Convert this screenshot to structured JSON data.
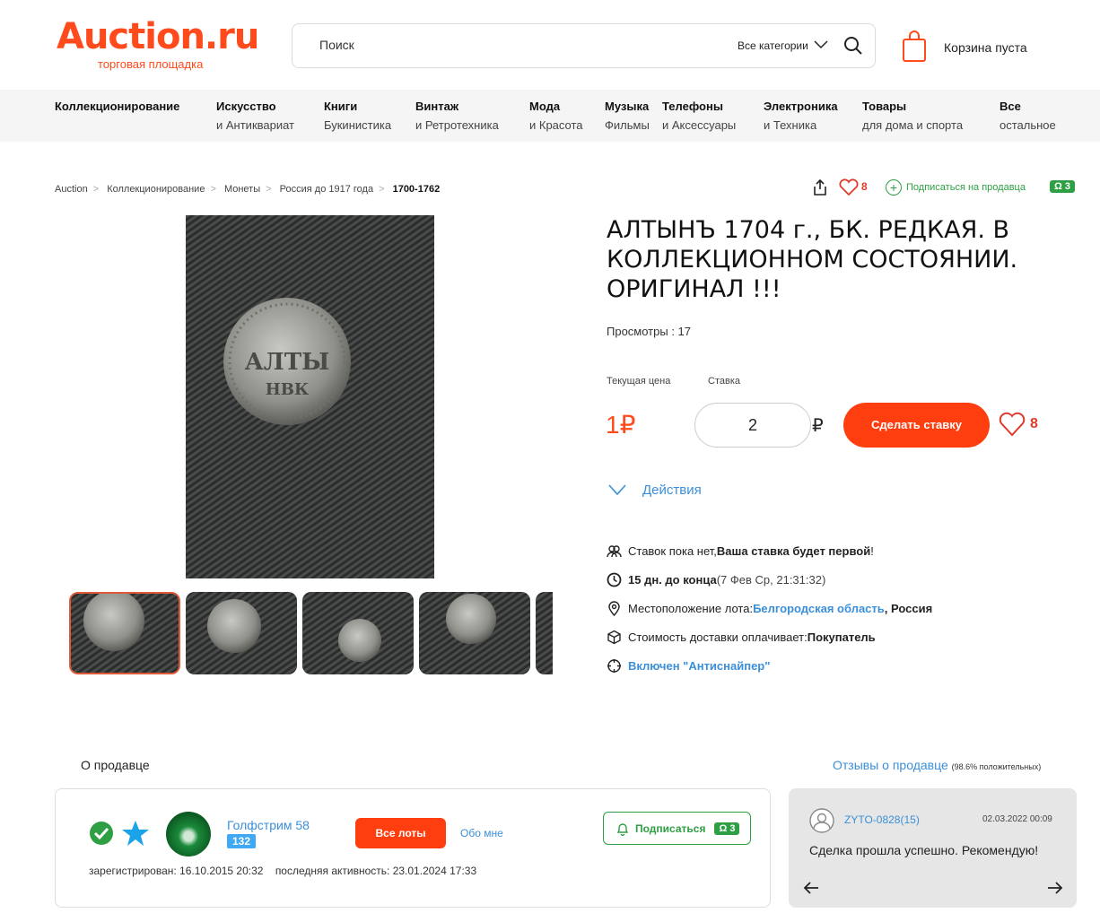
{
  "header": {
    "logo_main": "Auction.ru",
    "logo_sub": "торговая площадка",
    "search_placeholder": "Поиск",
    "category_select": "Все категории",
    "cart_text": "Корзина пуста"
  },
  "nav": [
    {
      "title": "Коллекционирование",
      "sub": ""
    },
    {
      "title": "Искусство",
      "sub": "и Антиквариат"
    },
    {
      "title": "Книги",
      "sub": "Букинистика"
    },
    {
      "title": "Винтаж",
      "sub": "и Ретротехника"
    },
    {
      "title": "Мода",
      "sub": "и Красота"
    },
    {
      "title": "Музыка",
      "sub": "Фильмы"
    },
    {
      "title": "Телефоны",
      "sub": "и Аксессуары"
    },
    {
      "title": "Электроника",
      "sub": "и Техника"
    },
    {
      "title": "Товары",
      "sub": "для дома и спорта"
    },
    {
      "title": "Все",
      "sub": "остальное"
    }
  ],
  "breadcrumbs": [
    "Auction",
    "Коллекционирование",
    "Монеты",
    "Россия до 1917 года",
    "1700-1762"
  ],
  "top_actions": {
    "favorites_count": "8",
    "subscribe_label": "Подписаться на продавца",
    "subscribers_count": "3"
  },
  "lot": {
    "title": "АЛТЫНЪ 1704 г., БК. РЕДКАЯ. В КОЛЛЕКЦИОННОМ СОСТОЯНИИ. ОРИГИНАЛ !!!",
    "views": "Просмотры : 17",
    "current_price_label": "Текущая цена",
    "bid_label": "Ставка",
    "current_price": "1₽",
    "bid_value": "2",
    "currency": "₽",
    "bid_button": "Сделать ставку",
    "favorites_count": "8",
    "actions_label": "Действия"
  },
  "info": {
    "bids_text": "Ставок пока нет, ",
    "bids_bold": "Ваша ставка будет первой",
    "bids_end": "!",
    "time_bold": "15 дн. до конца",
    "time_rest": " (7 Фев Ср, 21:31:32)",
    "location_label": "Местоположение лота: ",
    "location_region": "Белгородская область",
    "location_country": ", Россия",
    "delivery_label": "Стоимость доставки оплачивает: ",
    "delivery_value": "Покупатель",
    "antisniper": "Включен \"Антиснайпер\""
  },
  "seller": {
    "section_title": "О продавце",
    "reviews_link": "Отзывы о продавце",
    "reviews_pct": "(98.6% положительных)",
    "name": "Голфстрим 58",
    "rating": "132",
    "all_lots": "Все лоты",
    "about_me": "Обо мне",
    "subscribe": "Подписаться",
    "subscribers": "3",
    "registered": "зарегистрирован: 16.10.2015 20:32",
    "last_activity": "последняя активность: 23.01.2024 17:33"
  },
  "review": {
    "author": "ZYTO-0828(15)",
    "date": "02.03.2022 00:09",
    "text": "Сделка прошла успешно. Рекомендую!"
  },
  "colors": {
    "brand": "#ff4a1c",
    "link": "#3b8fd9",
    "green": "#2ea043"
  }
}
